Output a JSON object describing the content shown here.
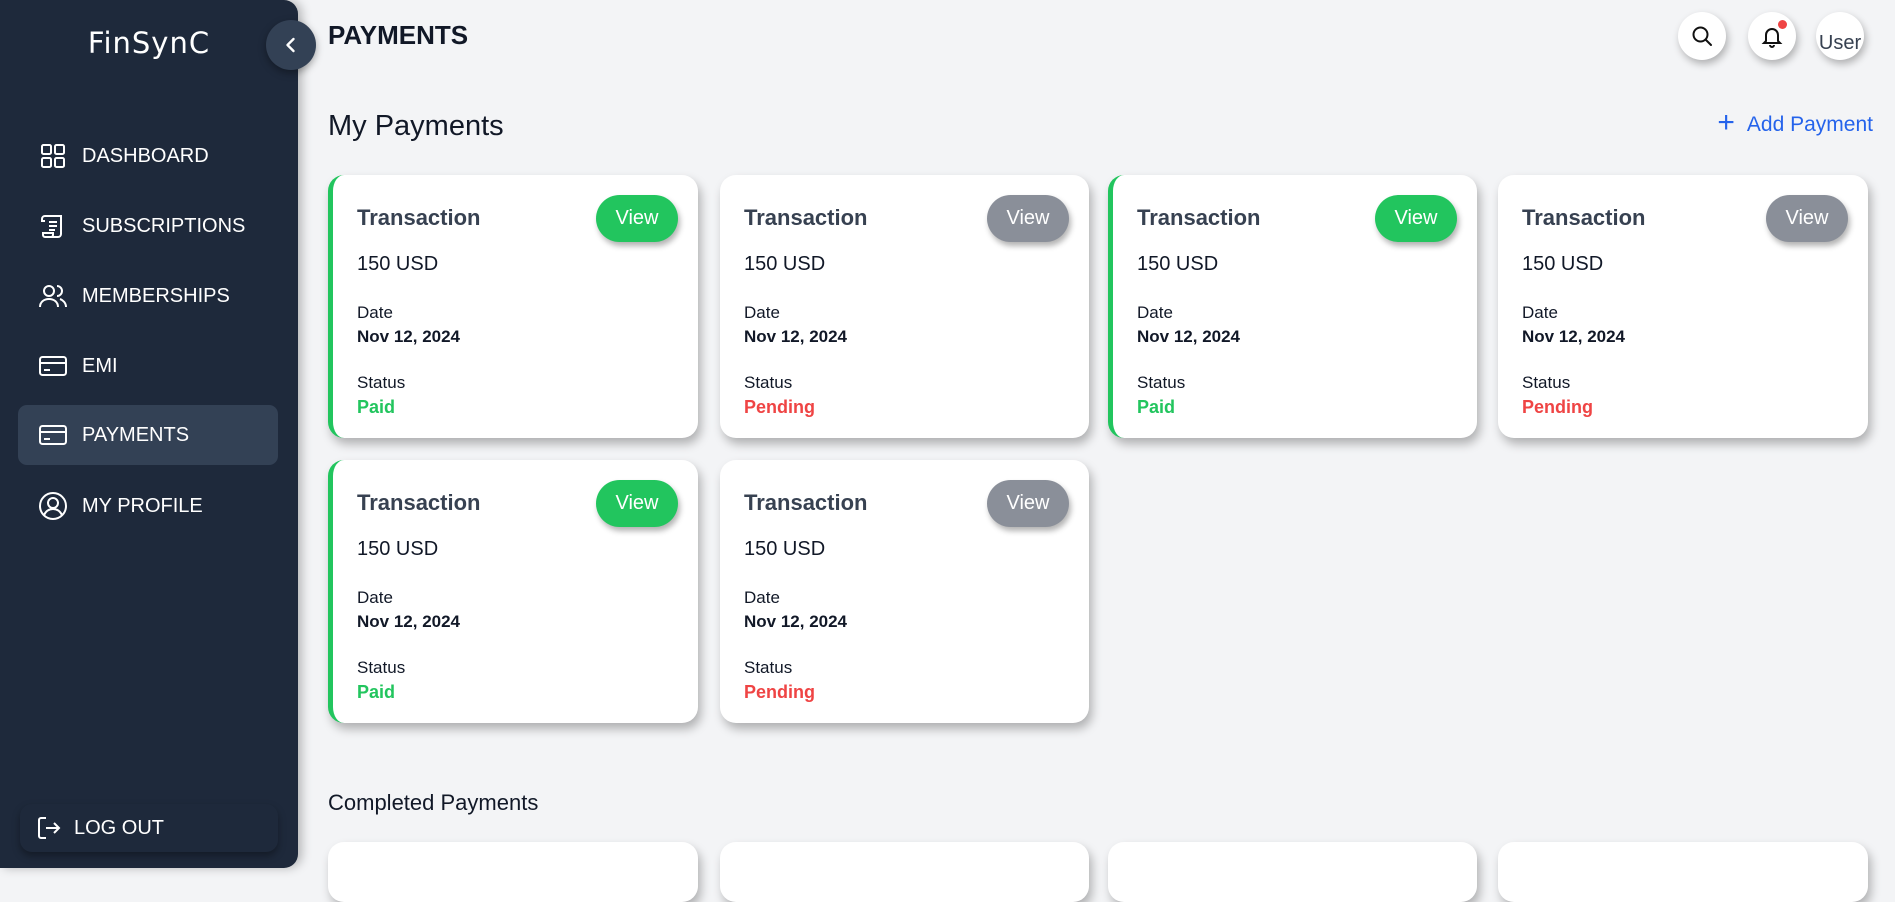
{
  "app": {
    "logo": "FinSynC"
  },
  "sidebar": {
    "items": [
      {
        "label": "DASHBOARD",
        "icon": "grid-icon"
      },
      {
        "label": "SUBSCRIPTIONS",
        "icon": "scroll-icon"
      },
      {
        "label": "MEMBERSHIPS",
        "icon": "users-icon"
      },
      {
        "label": "EMI",
        "icon": "card-icon"
      },
      {
        "label": "PAYMENTS",
        "icon": "card-icon",
        "active": true
      },
      {
        "label": "MY PROFILE",
        "icon": "user-circle-icon"
      }
    ],
    "logout_label": "LOG OUT"
  },
  "header": {
    "title": "PAYMENTS",
    "avatar_alt": "User",
    "has_notification": true
  },
  "main": {
    "section_title": "My Payments",
    "add_payment_label": "Add Payment",
    "completed_title": "Completed Payments",
    "cards": [
      {
        "title": "Transaction",
        "amount": "150 USD",
        "date_label": "Date",
        "date": "Nov 12, 2024",
        "status_label": "Status",
        "status": "Paid",
        "view_label": "View"
      },
      {
        "title": "Transaction",
        "amount": "150 USD",
        "date_label": "Date",
        "date": "Nov 12, 2024",
        "status_label": "Status",
        "status": "Pending",
        "view_label": "View"
      },
      {
        "title": "Transaction",
        "amount": "150 USD",
        "date_label": "Date",
        "date": "Nov 12, 2024",
        "status_label": "Status",
        "status": "Paid",
        "view_label": "View"
      },
      {
        "title": "Transaction",
        "amount": "150 USD",
        "date_label": "Date",
        "date": "Nov 12, 2024",
        "status_label": "Status",
        "status": "Pending",
        "view_label": "View"
      },
      {
        "title": "Transaction",
        "amount": "150 USD",
        "date_label": "Date",
        "date": "Nov 12, 2024",
        "status_label": "Status",
        "status": "Paid",
        "view_label": "View"
      },
      {
        "title": "Transaction",
        "amount": "150 USD",
        "date_label": "Date",
        "date": "Nov 12, 2024",
        "status_label": "Status",
        "status": "Pending",
        "view_label": "View"
      }
    ]
  },
  "colors": {
    "sidebar_bg": "#1e293b",
    "active_item_bg": "#334155",
    "paid": "#22c55e",
    "pending": "#ef4444",
    "view_gray": "#8a8f99",
    "accent_blue": "#2563eb"
  }
}
